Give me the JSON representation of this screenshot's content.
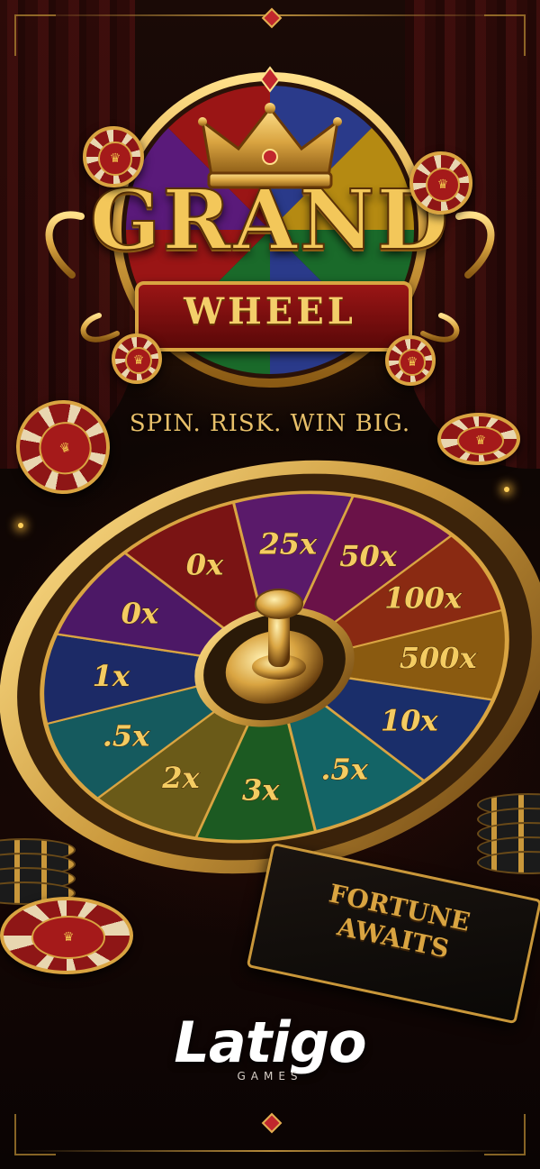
{
  "title": {
    "line1": "GRAND",
    "line2": "WHEEL"
  },
  "tagline": "SPIN. RISK. WIN BIG.",
  "wheel": {
    "segments": [
      {
        "label": "0x",
        "color": "#7a1414"
      },
      {
        "label": "25x",
        "color": "#5a1a6a"
      },
      {
        "label": "50x",
        "color": "#6a1248"
      },
      {
        "label": "100x",
        "color": "#8a2a12"
      },
      {
        "label": "500x",
        "color": "#8a5a10"
      },
      {
        "label": "10x",
        "color": "#1a2e6a"
      },
      {
        "label": ".5x",
        "color": "#136466"
      },
      {
        "label": "3x",
        "color": "#1c5a22"
      },
      {
        "label": "2x",
        "color": "#6a5a18"
      },
      {
        "label": ".5x",
        "color": "#155a5e"
      },
      {
        "label": "1x",
        "color": "#1c2a66"
      },
      {
        "label": "0x",
        "color": "#4c1866"
      }
    ],
    "rim_color": "#d9a441"
  },
  "sign": {
    "line1": "FORTUNE",
    "line2": "AWAITS"
  },
  "brand": {
    "name": "Latigo",
    "sub": "GAMES"
  },
  "chip_glyph": "♛",
  "colors": {
    "gold": "#f3c75a",
    "red": "#9a1515",
    "dark": "#0d0604"
  }
}
